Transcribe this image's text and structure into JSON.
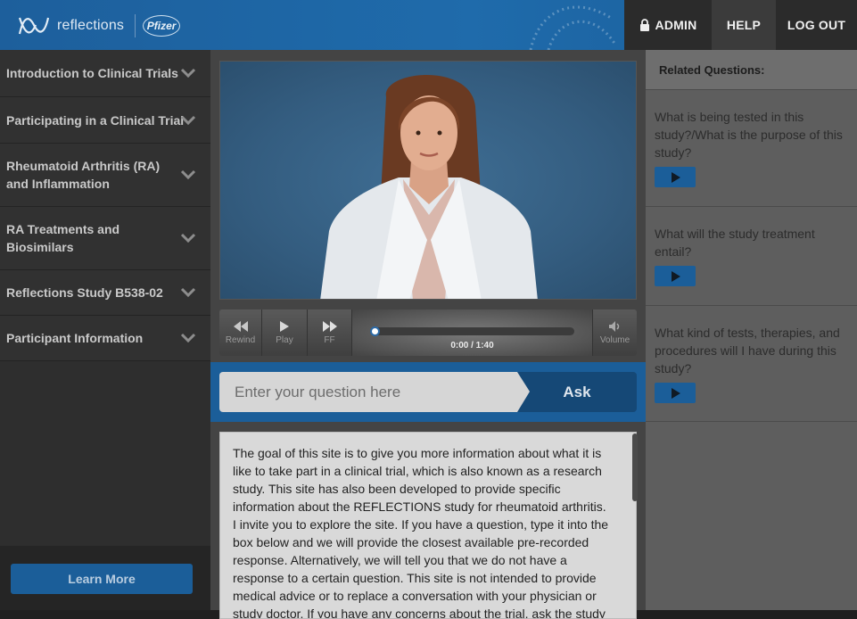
{
  "header": {
    "brand": "reflections",
    "partner": "Pfizer",
    "nav": {
      "admin": "ADMIN",
      "help": "HELP",
      "logout": "LOG OUT"
    }
  },
  "sidebar": {
    "items": [
      {
        "label": "Introduction to Clinical Trials"
      },
      {
        "label": "Participating in a Clinical Trial"
      },
      {
        "label": "Rheumatoid Arthritis (RA) and Inflammation"
      },
      {
        "label": "RA Treatments and Biosimilars"
      },
      {
        "label": "Reflections Study B538-02"
      },
      {
        "label": "Participant Information"
      }
    ],
    "learn_more": "Learn More"
  },
  "player": {
    "rewind": "Rewind",
    "play": "Play",
    "ff": "FF",
    "volume": "Volume",
    "time": "0:00 / 1:40",
    "progress": 0
  },
  "ask": {
    "placeholder": "Enter your question here",
    "button": "Ask"
  },
  "intro_text": "The goal of this site is to give you more information about what it is like to take part in a clinical trial, which is also known as a research study. This site has also been developed to provide specific information about the REFLECTIONS study for rheumatoid arthritis. I invite you to explore the site. If you have a question, type it into the box below and we will provide the closest available pre-recorded response. Alternatively, we will tell you that we do not have a response to a certain question. This site is not intended to provide medical advice or to replace a conversation with your physician or study doctor. If you have any concerns about the trial, ask the study staff.",
  "related": {
    "title": "Related Questions:",
    "questions": [
      {
        "text": "What is being tested in this study?/What is the purpose of this study?"
      },
      {
        "text": "What will the study treatment entail?"
      },
      {
        "text": "What kind of tests, therapies, and procedures will I have during this study?"
      }
    ]
  },
  "colors": {
    "brand_blue": "#1b5e99",
    "dark_blue": "#154876",
    "sidebar": "#313131"
  }
}
